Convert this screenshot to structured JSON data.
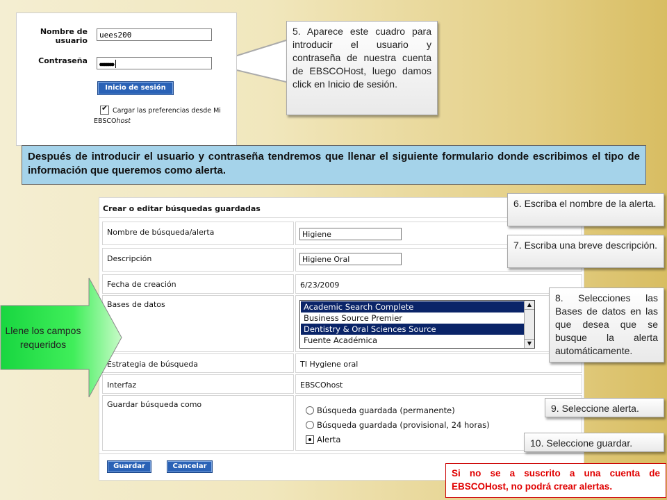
{
  "login": {
    "username_label": "Nombre de usuario",
    "username_value": "uees200",
    "password_label": "Contraseña",
    "password_value": "●●●●●●●",
    "signin_button": "Inicio de sesión",
    "prefs_text_1": "Cargar las preferencias desde Mi",
    "prefs_text_2": "EBSCO",
    "prefs_text_3": "host",
    "prefs_checked": true
  },
  "callouts": {
    "c5": "5. Aparece este cuadro para introducir el usuario y contraseña de nuestra cuenta de EBSCOHost, luego damos click en Inicio de sesión.",
    "c6": "6. Escriba el nombre de la alerta.",
    "c7": "7. Escriba una breve descripción.",
    "c8": "8. Selecciones las Bases de datos en las que desea que se busque la alerta automáticamente.",
    "c9": "9. Seleccione alerta.",
    "c10": "10. Seleccione guardar."
  },
  "banner": "Después de introducir el usuario y contraseña tendremos que llenar el siguiente formulario donde escribimos el tipo de información que queremos como alerta.",
  "arrow_text": "Llene los campos requeridos",
  "form": {
    "title": "Crear o editar búsquedas guardadas",
    "name_label": "Nombre de búsqueda/alerta",
    "name_value": "Higiene",
    "desc_label": "Descripción",
    "desc_value": "Higiene Oral",
    "date_label": "Fecha de creación",
    "date_value": "6/23/2009",
    "db_label": "Bases de datos",
    "databases": [
      {
        "label": "Academic Search Complete",
        "selected": true
      },
      {
        "label": "Business Source Premier",
        "selected": false
      },
      {
        "label": "Dentistry & Oral Sciences Source",
        "selected": true
      },
      {
        "label": "Fuente Académica",
        "selected": false
      }
    ],
    "strategy_label": "Estrategia de búsqueda",
    "strategy_value": "TI Hygiene oral",
    "interface_label": "Interfaz",
    "interface_value": "EBSCOhost",
    "saveas_label": "Guardar búsqueda como",
    "saveas_options": [
      {
        "label": "Búsqueda guardada (permanente)",
        "selected": false
      },
      {
        "label": "Búsqueda guardada (provisional, 24 horas)",
        "selected": false
      },
      {
        "label": "Alerta",
        "selected": true
      }
    ],
    "save_button": "Guardar",
    "cancel_button": "Cancelar"
  },
  "warning": "Si no se a suscrito a una cuenta de EBSCOHost, no podrá crear alertas.",
  "colors": {
    "banner_bg": "#a5d3ea",
    "button_blue": "#2a62b6",
    "list_selected": "#0a2468",
    "arrow_green": "#22dd44",
    "warning_red": "#e00000"
  }
}
